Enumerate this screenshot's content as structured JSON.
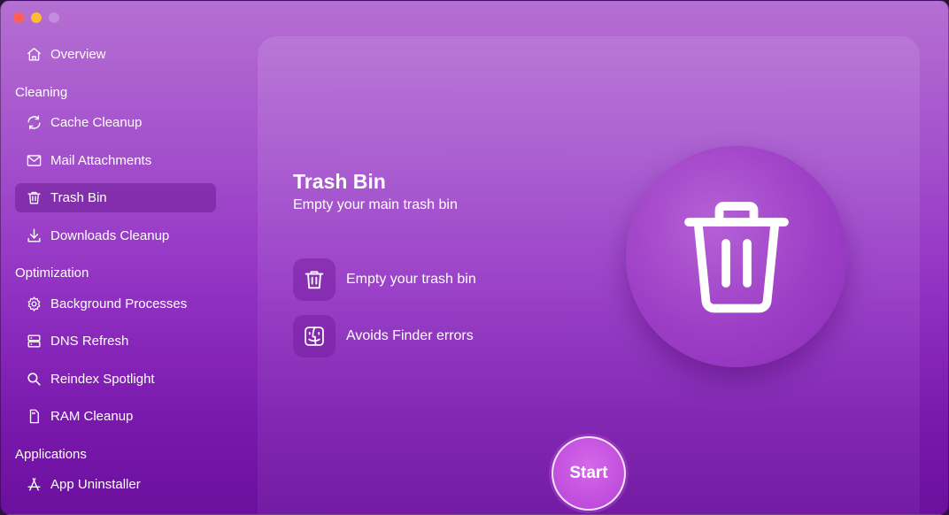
{
  "window": {
    "controls": [
      "close",
      "minimize",
      "zoom"
    ]
  },
  "sidebar": {
    "overview": {
      "label": "Overview",
      "icon": "home-icon"
    },
    "sections": [
      {
        "title": "Cleaning",
        "items": [
          {
            "label": "Cache Cleanup",
            "icon": "refresh-icon"
          },
          {
            "label": "Mail Attachments",
            "icon": "envelope-icon"
          },
          {
            "label": "Trash Bin",
            "icon": "trash-icon",
            "active": true
          },
          {
            "label": "Downloads Cleanup",
            "icon": "download-icon"
          }
        ]
      },
      {
        "title": "Optimization",
        "items": [
          {
            "label": "Background Processes",
            "icon": "gear-icon"
          },
          {
            "label": "DNS Refresh",
            "icon": "server-icon"
          },
          {
            "label": "Reindex Spotlight",
            "icon": "search-icon"
          },
          {
            "label": "RAM Cleanup",
            "icon": "memory-card-icon"
          }
        ]
      },
      {
        "title": "Applications",
        "items": [
          {
            "label": "App Uninstaller",
            "icon": "app-store-icon"
          }
        ]
      }
    ]
  },
  "main": {
    "title": "Trash Bin",
    "subtitle": "Empty your main trash bin",
    "features": [
      {
        "label": "Empty your trash bin",
        "icon": "trash-icon"
      },
      {
        "label": "Avoids Finder errors",
        "icon": "finder-icon"
      }
    ],
    "hero_icon": "trash-icon",
    "start_label": "Start"
  },
  "colors": {
    "accent": "#c04ddd",
    "background_top": "#b56fd2",
    "background_bottom": "#6b0f9e"
  }
}
